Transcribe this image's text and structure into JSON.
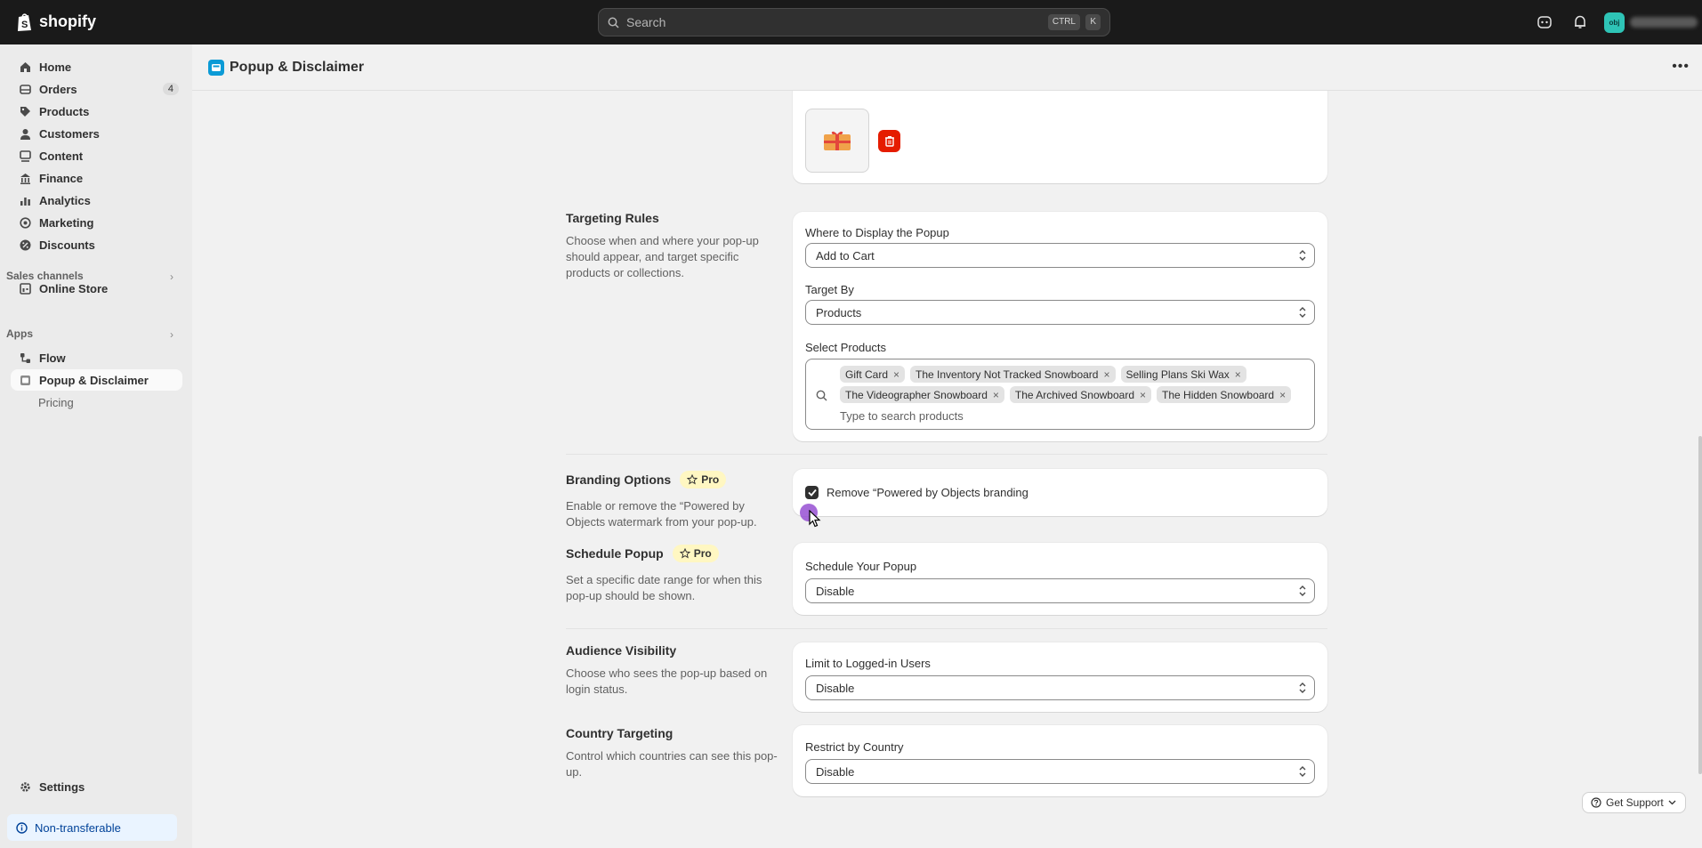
{
  "topbar": {
    "brand": "shopify",
    "search_placeholder": "Search",
    "shortcut_ctrl": "CTRL",
    "shortcut_key": "K",
    "avatar_initials": "obj"
  },
  "sidebar": {
    "items": [
      {
        "label": "Home",
        "icon": "home-icon"
      },
      {
        "label": "Orders",
        "icon": "orders-icon",
        "badge": "4"
      },
      {
        "label": "Products",
        "icon": "tag-icon"
      },
      {
        "label": "Customers",
        "icon": "person-icon"
      },
      {
        "label": "Content",
        "icon": "content-icon"
      },
      {
        "label": "Finance",
        "icon": "bank-icon"
      },
      {
        "label": "Analytics",
        "icon": "chart-icon"
      },
      {
        "label": "Marketing",
        "icon": "target-icon"
      },
      {
        "label": "Discounts",
        "icon": "discount-icon"
      }
    ],
    "sales_channels_label": "Sales channels",
    "online_store": "Online Store",
    "apps_label": "Apps",
    "flow": "Flow",
    "popup_app": "Popup & Disclaimer",
    "pricing": "Pricing",
    "settings": "Settings",
    "non_transferable": "Non-transferable"
  },
  "page": {
    "title": "Popup & Disclaimer"
  },
  "targeting": {
    "title": "Targeting Rules",
    "description": "Choose when and where your pop-up should appear, and target specific products or collections.",
    "where_label": "Where to Display the Popup",
    "where_value": "Add to Cart",
    "target_by_label": "Target By",
    "target_by_value": "Products",
    "select_products_label": "Select Products",
    "tags_row1": [
      "Gift Card",
      "The Inventory Not Tracked Snowboard",
      "Selling Plans Ski Wax"
    ],
    "tags_row2": [
      "The Videographer Snowboard",
      "The Archived Snowboard",
      "The Hidden Snowboard"
    ],
    "search_placeholder": "Type to search products"
  },
  "branding": {
    "title": "Branding Options",
    "pro": "Pro",
    "description": "Enable or remove the “Powered by Objects watermark from your pop-up.",
    "checkbox_label": "Remove “Powered by Objects branding",
    "checked": true
  },
  "schedule": {
    "title": "Schedule Popup",
    "pro": "Pro",
    "description": "Set a specific date range for when this pop-up should be shown.",
    "label": "Schedule Your Popup",
    "value": "Disable"
  },
  "audience": {
    "title": "Audience Visibility",
    "description": "Choose who sees the pop-up based on login status.",
    "label": "Limit to Logged-in Users",
    "value": "Disable"
  },
  "country": {
    "title": "Country Targeting",
    "description": "Control which countries can see this pop-up.",
    "label": "Restrict by Country",
    "value": "Disable"
  },
  "support": {
    "label": "Get Support"
  },
  "colors": {
    "topbar": "#1a1a1a",
    "sidebar": "#ebebeb",
    "page_bg": "#f1f1f1",
    "delete_red": "#e51c00",
    "pro_badge": "#fff7c2",
    "non_transferable_bg": "#eaf4ff"
  }
}
